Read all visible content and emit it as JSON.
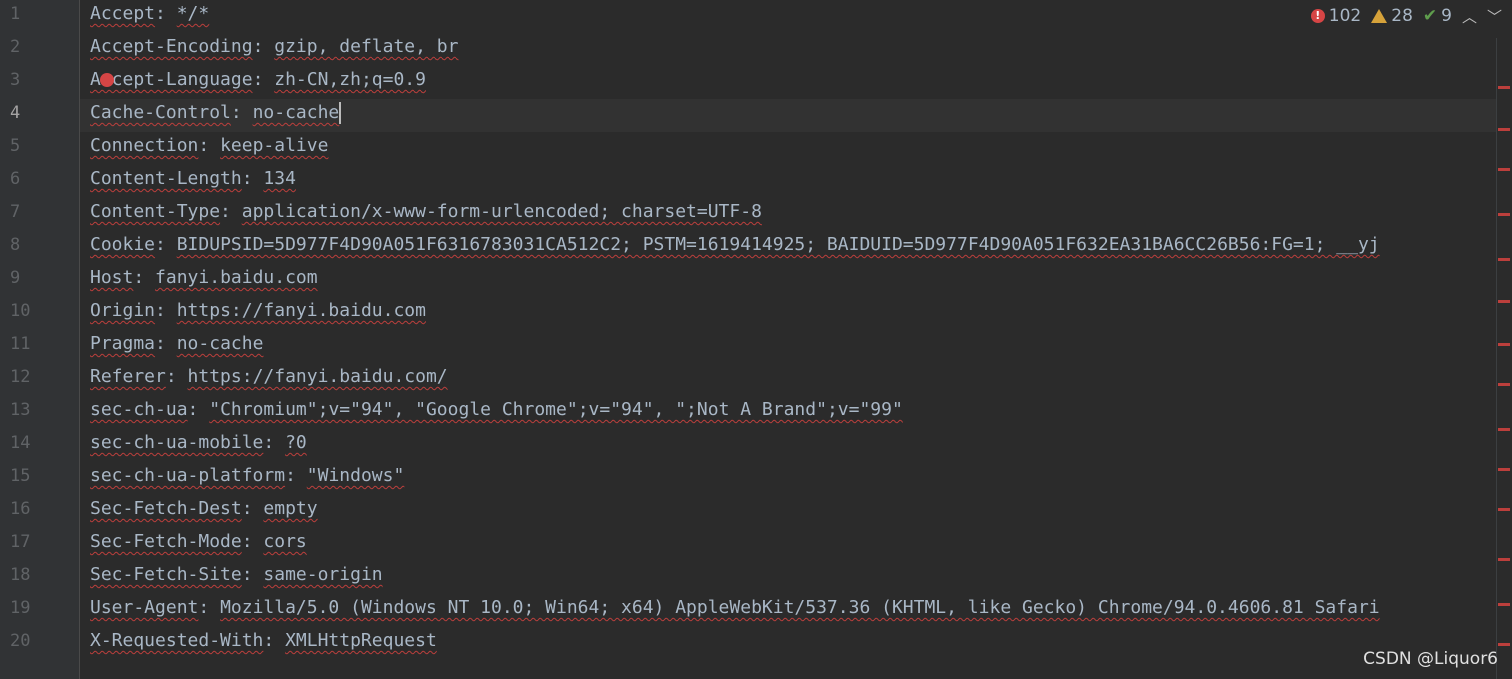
{
  "inspections": {
    "errors": "102",
    "warnings": "28",
    "weak_warnings": "9",
    "error_icon": "error-icon",
    "warning_icon": "warning-icon",
    "check_icon": "check-icon"
  },
  "lines": [
    {
      "num": "1",
      "key": "Accept",
      "value": "*/*"
    },
    {
      "num": "2",
      "key": "Accept-Encoding",
      "value": "gzip, deflate, br"
    },
    {
      "num": "3",
      "key": "Accept-Language",
      "value": "zh-CN,zh;q=0.9"
    },
    {
      "num": "4",
      "key": "Cache-Control",
      "value": "no-cache"
    },
    {
      "num": "5",
      "key": "Connection",
      "value": "keep-alive"
    },
    {
      "num": "6",
      "key": "Content-Length",
      "value": "134"
    },
    {
      "num": "7",
      "key": "Content-Type",
      "value": "application/x-www-form-urlencoded; charset=UTF-8"
    },
    {
      "num": "8",
      "key": "Cookie",
      "value": "BIDUPSID=5D977F4D90A051F6316783031CA512C2; PSTM=1619414925; BAIDUID=5D977F4D90A051F632EA31BA6CC26B56:FG=1; __yj"
    },
    {
      "num": "9",
      "key": "Host",
      "value": "fanyi.baidu.com"
    },
    {
      "num": "10",
      "key": "Origin",
      "value": "https://fanyi.baidu.com"
    },
    {
      "num": "11",
      "key": "Pragma",
      "value": "no-cache"
    },
    {
      "num": "12",
      "key": "Referer",
      "value": "https://fanyi.baidu.com/"
    },
    {
      "num": "13",
      "key": "sec-ch-ua",
      "value": "\"Chromium\";v=\"94\", \"Google Chrome\";v=\"94\", \";Not A Brand\";v=\"99\""
    },
    {
      "num": "14",
      "key": "sec-ch-ua-mobile",
      "value": "?0"
    },
    {
      "num": "15",
      "key": "sec-ch-ua-platform",
      "value": "\"Windows\""
    },
    {
      "num": "16",
      "key": "Sec-Fetch-Dest",
      "value": "empty"
    },
    {
      "num": "17",
      "key": "Sec-Fetch-Mode",
      "value": "cors"
    },
    {
      "num": "18",
      "key": "Sec-Fetch-Site",
      "value": "same-origin"
    },
    {
      "num": "19",
      "key": "User-Agent",
      "value": "Mozilla/5.0 (Windows NT 10.0; Win64; x64) AppleWebKit/537.36 (KHTML, like Gecko) Chrome/94.0.4606.81 Safari"
    },
    {
      "num": "20",
      "key": "X-Requested-With",
      "value": "XMLHttpRequest"
    }
  ],
  "current_line": "4",
  "watermark": "CSDN @Liquor6",
  "colors": {
    "background": "#2b2b2b",
    "gutter": "#313335",
    "text": "#a9b7c6",
    "number": "#6897bb",
    "string": "#6a8759",
    "error": "#d64545",
    "warning": "#d6a23a"
  }
}
